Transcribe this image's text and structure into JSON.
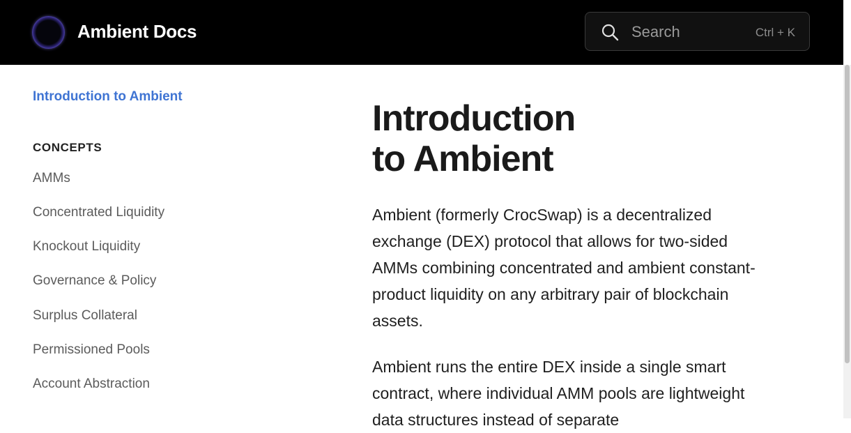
{
  "header": {
    "brand": "Ambient Docs",
    "search": {
      "placeholder": "Search",
      "shortcut": "Ctrl + K"
    }
  },
  "sidebar": {
    "active_link": "Introduction to Ambient",
    "section_heading": "CONCEPTS",
    "items": [
      "AMMs",
      "Concentrated Liquidity",
      "Knockout Liquidity",
      "Governance & Policy",
      "Surplus Collateral",
      "Permissioned Pools",
      "Account Abstraction"
    ]
  },
  "main": {
    "title_line1": "Introduction",
    "title_line2": "to Ambient",
    "paragraph1": "Ambient (formerly CrocSwap) is a decentralized exchange (DEX) protocol that allows for two-sided AMMs combining concentrated and ambient constant-product liquidity on any arbitrary pair of blockchain assets.",
    "paragraph2": "Ambient runs the entire DEX inside a single smart contract, where individual AMM pools are lightweight data structures instead of separate"
  },
  "colors": {
    "header_bg": "#000000",
    "accent_link": "#3f74d3",
    "text": "#1f1f1f",
    "muted_text": "#5b5b5b"
  }
}
